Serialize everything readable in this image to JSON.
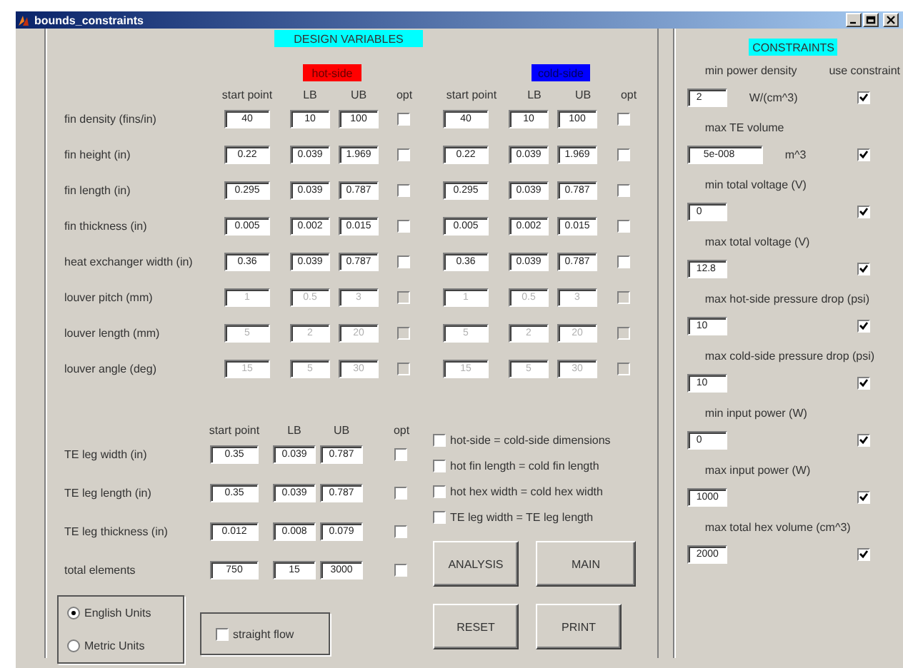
{
  "window": {
    "title": "bounds_constraints"
  },
  "design_variables": {
    "title": "DESIGN VARIABLES",
    "sides": [
      {
        "label": "hot-side",
        "color": "#ff0000",
        "headers": [
          "start point",
          "LB",
          "UB",
          "opt"
        ]
      },
      {
        "label": "cold-side",
        "color": "#0000ff",
        "headers": [
          "start point",
          "LB",
          "UB",
          "opt"
        ]
      }
    ],
    "rows": [
      {
        "label": "fin density (fins/in)",
        "disabled": false,
        "values": [
          {
            "start": "40",
            "lb": "10",
            "ub": "100",
            "opt": false
          },
          {
            "start": "40",
            "lb": "10",
            "ub": "100",
            "opt": false
          }
        ]
      },
      {
        "label": "fin height (in)",
        "disabled": false,
        "values": [
          {
            "start": "0.22",
            "lb": "0.039",
            "ub": "1.969",
            "opt": false
          },
          {
            "start": "0.22",
            "lb": "0.039",
            "ub": "1.969",
            "opt": false
          }
        ]
      },
      {
        "label": "fin length (in)",
        "disabled": false,
        "values": [
          {
            "start": "0.295",
            "lb": "0.039",
            "ub": "0.787",
            "opt": false
          },
          {
            "start": "0.295",
            "lb": "0.039",
            "ub": "0.787",
            "opt": false
          }
        ]
      },
      {
        "label": "fin thickness (in)",
        "disabled": false,
        "values": [
          {
            "start": "0.005",
            "lb": "0.002",
            "ub": "0.015",
            "opt": false
          },
          {
            "start": "0.005",
            "lb": "0.002",
            "ub": "0.015",
            "opt": false
          }
        ]
      },
      {
        "label": "heat exchanger width (in)",
        "disabled": false,
        "values": [
          {
            "start": "0.36",
            "lb": "0.039",
            "ub": "0.787",
            "opt": false
          },
          {
            "start": "0.36",
            "lb": "0.039",
            "ub": "0.787",
            "opt": false
          }
        ]
      },
      {
        "label": "louver pitch (mm)",
        "disabled": true,
        "values": [
          {
            "start": "1",
            "lb": "0.5",
            "ub": "3",
            "opt": false
          },
          {
            "start": "1",
            "lb": "0.5",
            "ub": "3",
            "opt": false
          }
        ]
      },
      {
        "label": "louver length (mm)",
        "disabled": true,
        "values": [
          {
            "start": "5",
            "lb": "2",
            "ub": "20",
            "opt": false
          },
          {
            "start": "5",
            "lb": "2",
            "ub": "20",
            "opt": false
          }
        ]
      },
      {
        "label": "louver angle (deg)",
        "disabled": true,
        "values": [
          {
            "start": "15",
            "lb": "5",
            "ub": "30",
            "opt": false
          },
          {
            "start": "15",
            "lb": "5",
            "ub": "30",
            "opt": false
          }
        ]
      }
    ]
  },
  "te": {
    "headers": [
      "start point",
      "LB",
      "UB",
      "opt"
    ],
    "rows": [
      {
        "label": "TE leg width (in)",
        "start": "0.35",
        "lb": "0.039",
        "ub": "0.787",
        "opt": false
      },
      {
        "label": "TE leg length (in)",
        "start": "0.35",
        "lb": "0.039",
        "ub": "0.787",
        "opt": false
      },
      {
        "label": "TE leg thickness (in)",
        "start": "0.012",
        "lb": "0.008",
        "ub": "0.079",
        "opt": false
      },
      {
        "label": "total elements",
        "start": "750",
        "lb": "15",
        "ub": "3000",
        "opt": false
      }
    ]
  },
  "links": [
    {
      "label": "hot-side = cold-side dimensions",
      "checked": false
    },
    {
      "label": "hot fin length = cold fin length",
      "checked": false
    },
    {
      "label": "hot hex width = cold hex width",
      "checked": false
    },
    {
      "label": "TE leg width = TE leg length",
      "checked": false
    }
  ],
  "units": [
    {
      "label": "English Units",
      "selected": true
    },
    {
      "label": "Metric Units",
      "selected": false
    }
  ],
  "straight_flow": {
    "label": "straight flow",
    "checked": false
  },
  "buttons": [
    "ANALYSIS",
    "MAIN",
    "RESET",
    "PRINT"
  ],
  "constraints": {
    "title": "CONSTRAINTS",
    "use_header": "use constraint",
    "items": [
      {
        "label": "min power density",
        "value": "2",
        "unit": "W/(cm^3)",
        "checked": true
      },
      {
        "label": "max TE volume",
        "value": "5e-008",
        "unit": "m^3",
        "checked": true
      },
      {
        "label": "min total voltage (V)",
        "value": "0",
        "checked": true
      },
      {
        "label": "max total voltage (V)",
        "value": "12.8",
        "checked": true
      },
      {
        "label": "max hot-side pressure drop (psi)",
        "value": "10",
        "checked": true
      },
      {
        "label": "max cold-side pressure drop (psi)",
        "value": "10",
        "checked": true
      },
      {
        "label": "min input power (W)",
        "value": "0",
        "checked": true
      },
      {
        "label": "max input power (W)",
        "value": "1000",
        "checked": true
      },
      {
        "label": "max total hex volume (cm^3)",
        "value": "2000",
        "checked": true
      }
    ]
  }
}
